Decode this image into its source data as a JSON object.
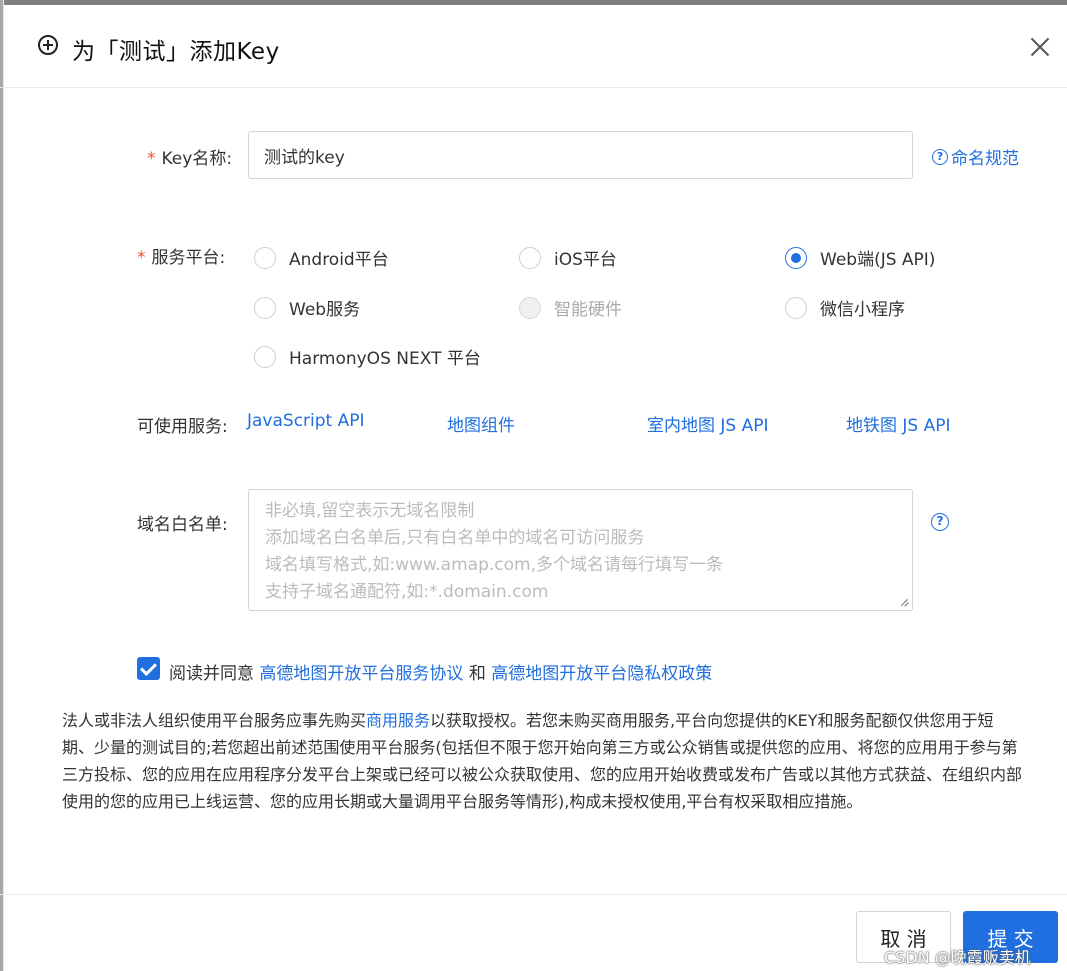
{
  "dialog": {
    "title": "为「测试」添加Key",
    "icons": {
      "title": "plus-circle-icon",
      "close": "close-icon"
    }
  },
  "key_name": {
    "label": "Key名称:",
    "required_mark": "*",
    "value": "测试的key",
    "help_link": "命名规范"
  },
  "platform": {
    "label": "服务平台:",
    "required_mark": "*",
    "options": [
      {
        "label": "Android平台",
        "checked": false,
        "disabled": false
      },
      {
        "label": "iOS平台",
        "checked": false,
        "disabled": false
      },
      {
        "label": "Web端(JS API)",
        "checked": true,
        "disabled": false
      },
      {
        "label": "Web服务",
        "checked": false,
        "disabled": false
      },
      {
        "label": "智能硬件",
        "checked": false,
        "disabled": true
      },
      {
        "label": "微信小程序",
        "checked": false,
        "disabled": false
      },
      {
        "label": "HarmonyOS NEXT 平台",
        "checked": false,
        "disabled": false
      }
    ]
  },
  "services": {
    "label": "可使用服务:",
    "items": [
      "JavaScript API",
      "地图组件",
      "室内地图 JS API",
      "地铁图 JS API"
    ]
  },
  "whitelist": {
    "label": "域名白名单:",
    "placeholder": "非必填,留空表示无域名限制\n添加域名白名单后,只有白名单中的域名可访问服务\n域名填写格式,如:www.amap.com,多个域名请每行填写一条\n支持子域名通配符,如:*.domain.com",
    "value": ""
  },
  "agreement": {
    "checked": true,
    "prefix": "阅读并同意",
    "link1": "高德地图开放平台服务协议",
    "conjunction": "和",
    "link2": "高德地图开放平台隐私权政策"
  },
  "notice": {
    "before": "法人或非法人组织使用平台服务应事先购买",
    "link": "商用服务",
    "after": "以获取授权。若您未购买商用服务,平台向您提供的KEY和服务配额仅供您用于短期、少量的测试目的;若您超出前述范围使用平台服务(包括但不限于您开始向第三方或公众销售或提供您的应用、将您的应用用于参与第三方投标、您的应用在应用程序分发平台上架或已经可以被公众获取使用、您的应用开始收费或发布广告或以其他方式获益、在组织内部使用的您的应用已上线运营、您的应用长期或大量调用平台服务等情形),构成未授权使用,平台有权采取相应措施。"
  },
  "footer": {
    "cancel": "取 消",
    "submit": "提 交"
  },
  "watermark": "CSDN @晚霞贩卖机",
  "colors": {
    "primary": "#1f6fe0",
    "required": "#f0522e"
  }
}
